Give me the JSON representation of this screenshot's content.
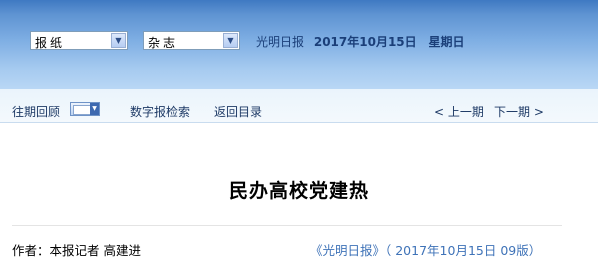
{
  "header": {
    "select_newspaper": "报纸",
    "select_magazine": "杂志",
    "paper_name": "光明日报",
    "date": "2017年10月15日",
    "weekday": "星期日"
  },
  "nav": {
    "past_issues": "往期回顾",
    "digital_search": "数字报检索",
    "back_to_contents": "返回目录",
    "prev_issue": "< 上一期",
    "next_issue": "下一期 >"
  },
  "article": {
    "title": "民办高校党建热",
    "author": "作者：本报记者 高建进",
    "source": "《光明日报》（ 2017年10月15日 09版）"
  },
  "icons": {
    "dropdown": "chevron-down-icon",
    "calendar": "calendar-icon"
  },
  "colors": {
    "header_top": "#3f79c2",
    "header_bottom": "#b9d7f5",
    "nav_bg": "#eaf4fc",
    "link_blue": "#3f73b8",
    "nav_text": "#1e3a66"
  }
}
